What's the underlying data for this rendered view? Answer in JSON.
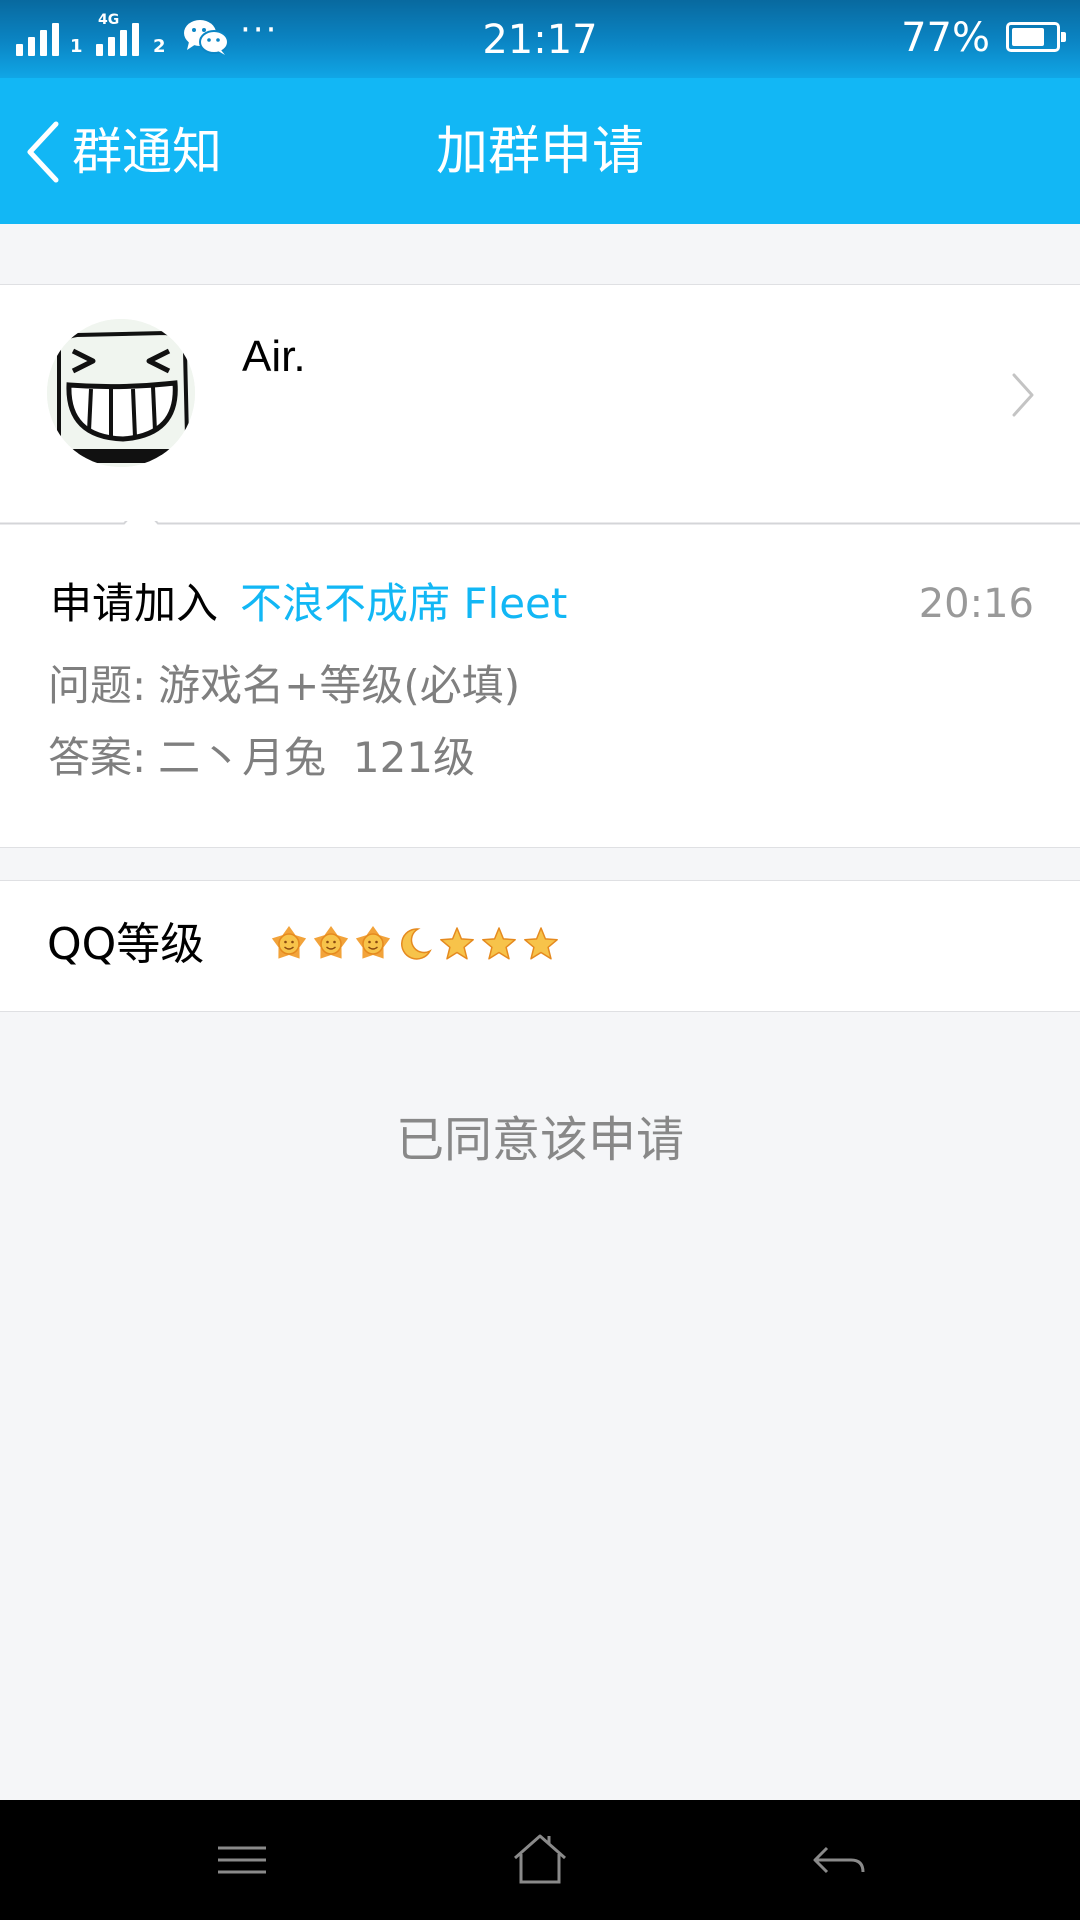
{
  "status_bar": {
    "network_type": "4G",
    "sim1": "1",
    "sim2": "2",
    "more_indicator": "···",
    "time": "21:17",
    "battery_percent": "77%",
    "battery_level": 0.77,
    "notification_icons": [
      "wechat-icon"
    ]
  },
  "header": {
    "back_label": "群通知",
    "title": "加群申请",
    "background_color": "#12b7f5"
  },
  "applicant": {
    "name": "Air.",
    "avatar_icon": "grinning-face-avatar"
  },
  "request": {
    "prefix": "申请加入",
    "group_name": "不浪不成席 Fleet",
    "time": "20:16",
    "question_label": "问题:",
    "question_text": "游戏名+等级(必填)",
    "answer_label": "答案:",
    "answer_text": "二丶月兔  121级"
  },
  "qq_level": {
    "label": "QQ等级",
    "icons": [
      "sun-icon",
      "sun-icon",
      "sun-icon",
      "moon-icon",
      "star-icon",
      "star-icon",
      "star-icon"
    ]
  },
  "status": {
    "text": "已同意该申请"
  },
  "nav_bar": {
    "buttons": [
      "menu-icon",
      "home-icon",
      "back-icon"
    ]
  },
  "colors": {
    "accent": "#12b7f5",
    "page_background": "#f5f6f8",
    "secondary_text": "#888888"
  }
}
